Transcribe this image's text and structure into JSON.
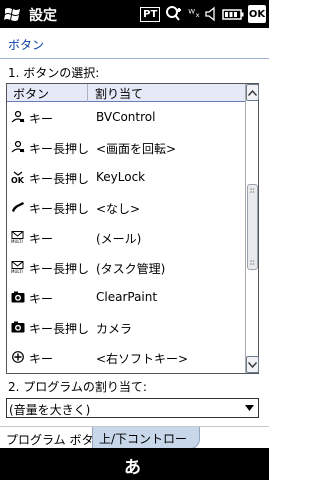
{
  "titlebar": {
    "title": "設定",
    "status": {
      "pt": "PT",
      "signal": "ᵂₓ",
      "ok": "OK"
    }
  },
  "page": {
    "heading": "ボタン",
    "section1_label": "1. ボタンの選択:",
    "section2_label": "2. プログラムの割り当て:"
  },
  "table": {
    "headers": {
      "button": "ボタン",
      "assignment": "割り当て"
    },
    "rows": [
      {
        "icon": "mic-person-icon",
        "key": "キー",
        "assign": "BVControl"
      },
      {
        "icon": "mic-person-icon",
        "key": "キー長押し",
        "assign": "<画面を回転>"
      },
      {
        "icon": "ok-key-icon",
        "key": "キー長押し",
        "assign": "KeyLock"
      },
      {
        "icon": "phone-icon",
        "key": "キー長押し",
        "assign": "<なし>"
      },
      {
        "icon": "multi-mail-icon",
        "key": "キー",
        "assign": "(メール)"
      },
      {
        "icon": "multi-mail-icon",
        "key": "キー長押し",
        "assign": "(タスク管理)"
      },
      {
        "icon": "camera-icon",
        "key": "キー",
        "assign": "ClearPaint"
      },
      {
        "icon": "camera-icon",
        "key": "キー長押し",
        "assign": "カメラ"
      },
      {
        "icon": "plus-circle-icon",
        "key": "キー",
        "assign": "<右ソフトキー>"
      }
    ]
  },
  "dropdown": {
    "value": "(音量を大きく)"
  },
  "tabs": {
    "program_button": "プログラム ボタン",
    "updown_control": "上/下コントロール"
  },
  "bottombar": {
    "ime": "あ"
  }
}
